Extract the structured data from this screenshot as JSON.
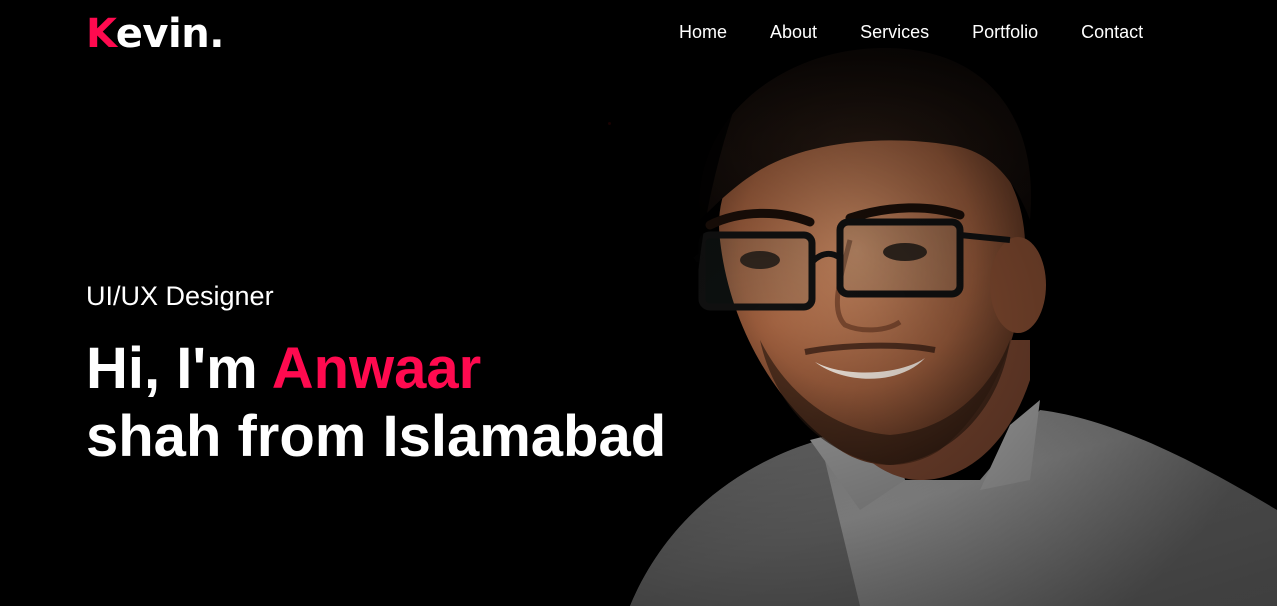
{
  "brand": {
    "first_letter": "K",
    "rest": "evin."
  },
  "nav": {
    "items": [
      {
        "label": "Home"
      },
      {
        "label": "About"
      },
      {
        "label": "Services"
      },
      {
        "label": "Portfolio"
      },
      {
        "label": "Contact"
      }
    ]
  },
  "hero": {
    "role": "UI/UX Designer",
    "greeting": "Hi, I'm",
    "name": "Anwaar",
    "line2": "shah from Islamabad"
  },
  "colors": {
    "accent": "#ff0a4f",
    "background": "#000000",
    "text": "#ffffff"
  }
}
